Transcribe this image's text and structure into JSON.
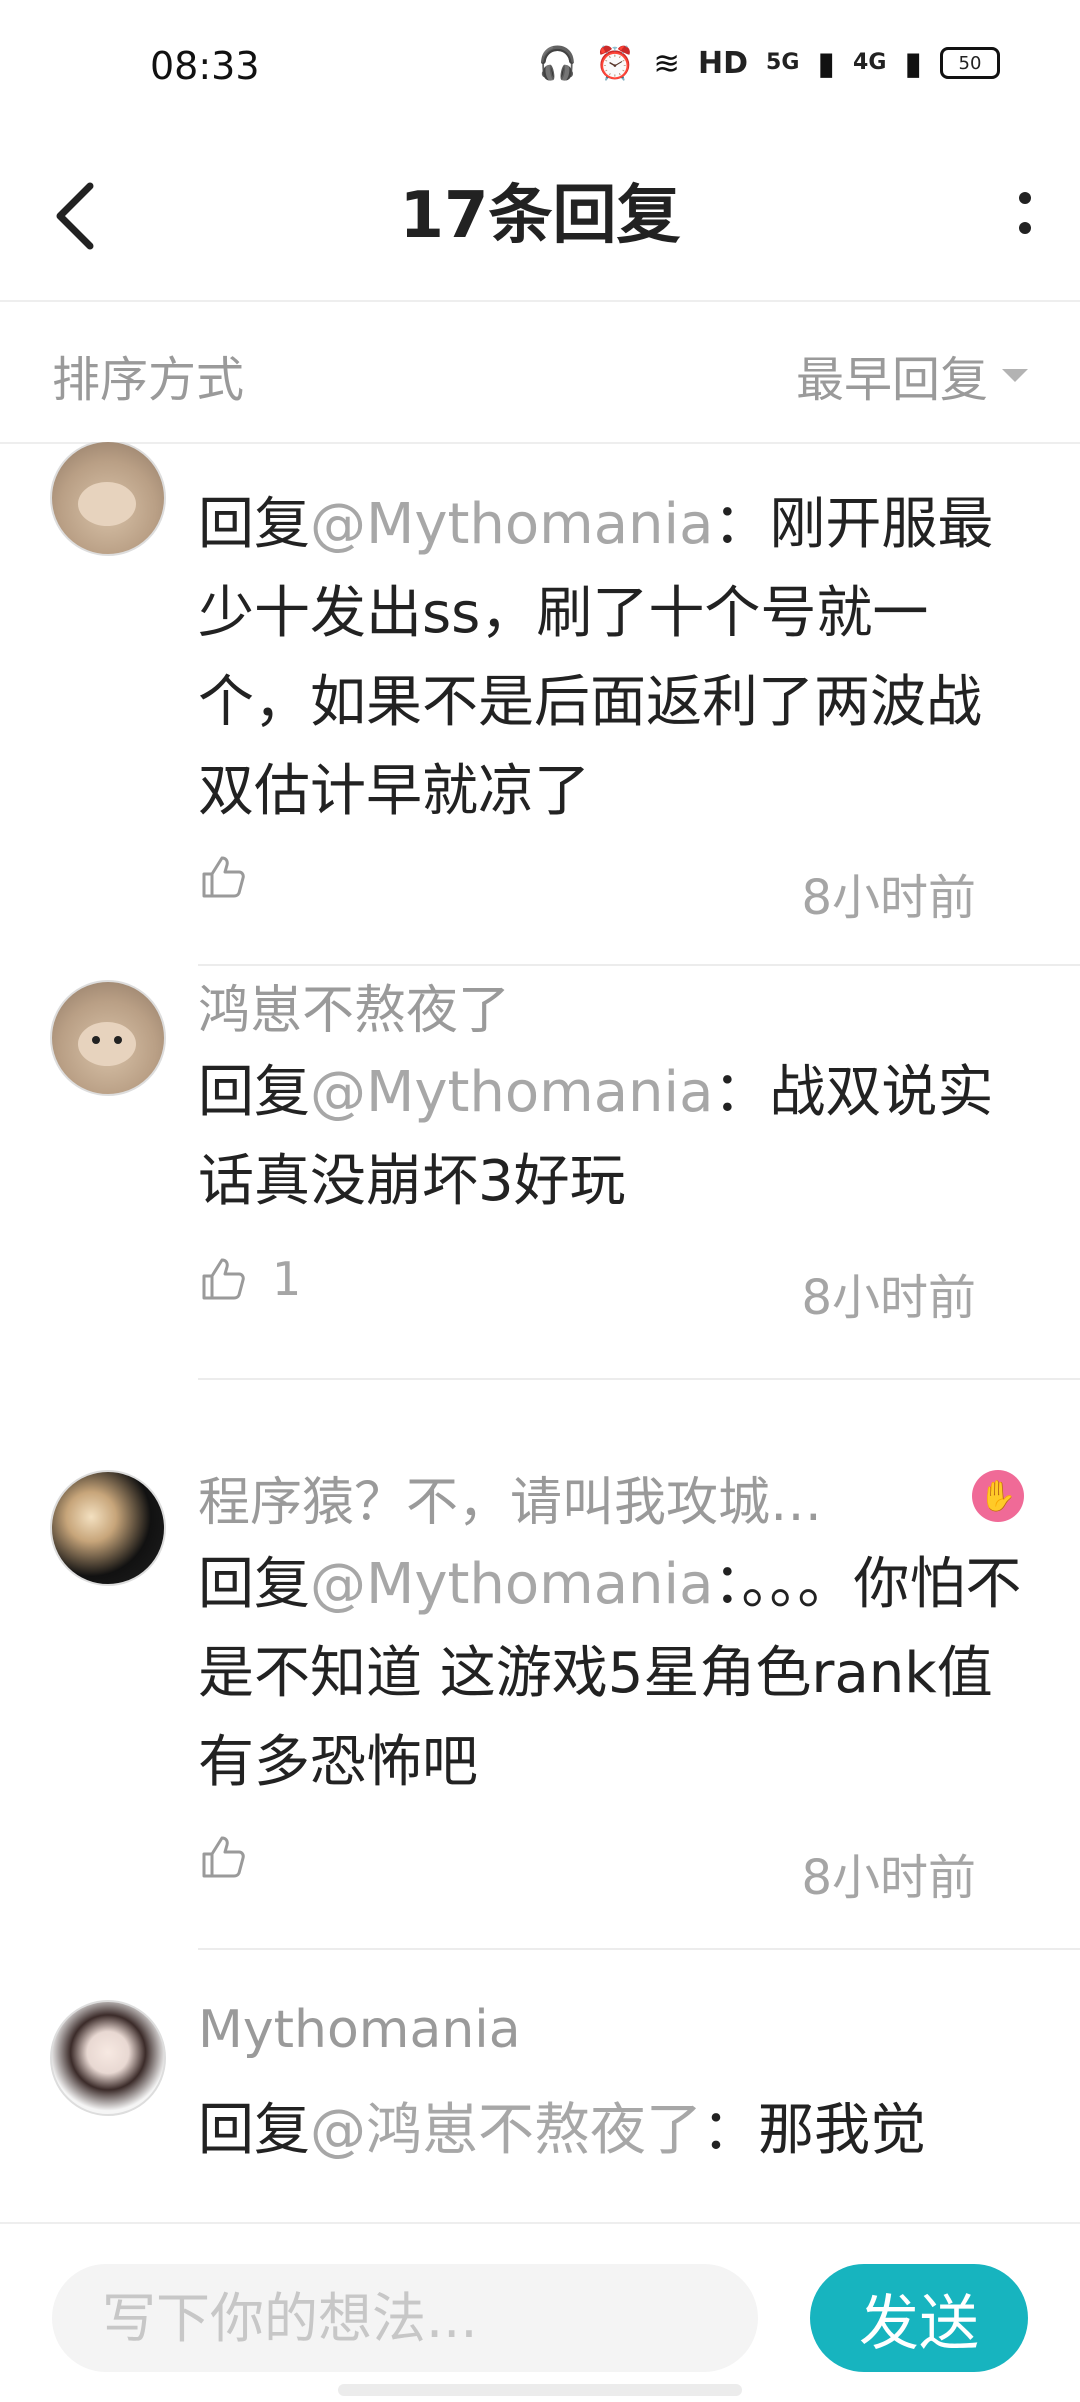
{
  "status_bar": {
    "time": "08:33",
    "hd": "HD",
    "net_a": "5G",
    "net_b": "4G",
    "battery": "50"
  },
  "header": {
    "title": "17条回复"
  },
  "sort": {
    "label": "排序方式",
    "selected": "最早回复"
  },
  "comments": [
    {
      "user": "",
      "prefix": "回复",
      "mention": "@Mythomania",
      "colon": "：",
      "text": "刚开服最少十发出ss，刷了十个号就一个，如果不是后面返利了两波战双估计早就凉了",
      "likes": "",
      "time": "8小时前"
    },
    {
      "user": "鸿崽不熬夜了",
      "prefix": "回复",
      "mention": "@Mythomania",
      "colon": "：",
      "text": "战双说实话真没崩坏3好玩",
      "likes": "1",
      "time": "8小时前"
    },
    {
      "user": "程序猿？不，请叫我攻城…",
      "prefix": "回复",
      "mention": "@Mythomania",
      "colon": "：",
      "text": "。。。你怕不是不知道 这游戏5星角色rank值有多恐怖吧",
      "likes": "",
      "time": "8小时前"
    },
    {
      "user": "Mythomania",
      "prefix": "回复",
      "mention": "@鸿崽不熬夜了",
      "colon": "：",
      "text": "那我觉",
      "likes": "",
      "time": ""
    }
  ],
  "compose": {
    "placeholder": "写下你的想法...",
    "send_label": "发送"
  },
  "colors": {
    "accent": "#17b4bf",
    "muted_text": "#9a9a9a",
    "badge_pink": "#f06a97"
  }
}
